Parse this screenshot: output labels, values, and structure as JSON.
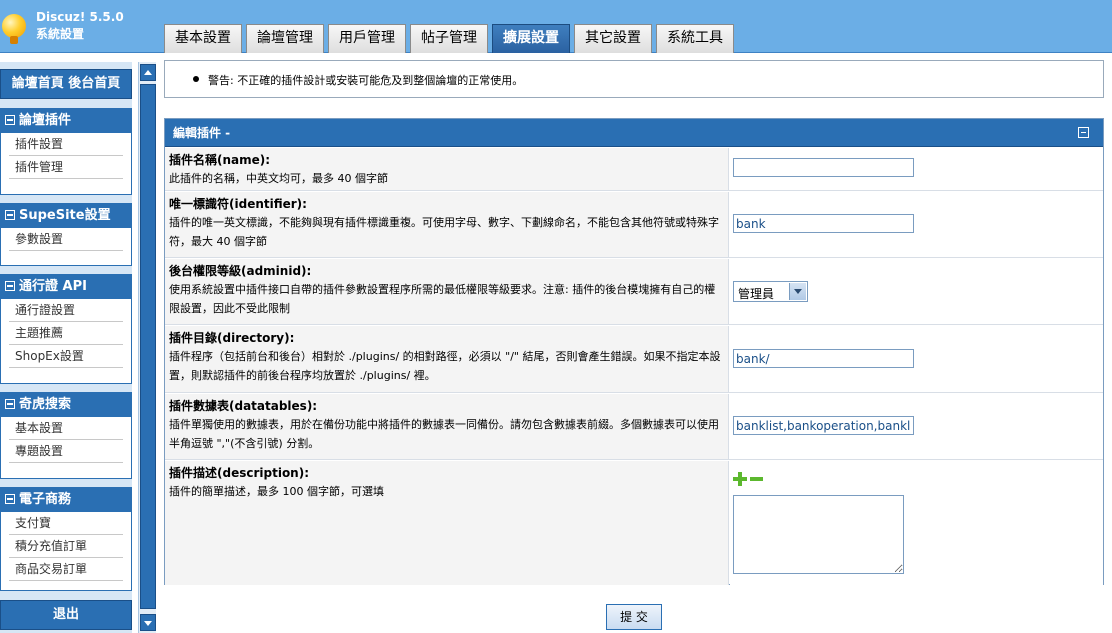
{
  "app": {
    "name": "Discuz! 5.5.0",
    "subtitle": "系統設置"
  },
  "tabs": [
    {
      "label": "基本設置",
      "active": false
    },
    {
      "label": "論壇管理",
      "active": false
    },
    {
      "label": "用戶管理",
      "active": false
    },
    {
      "label": "帖子管理",
      "active": false
    },
    {
      "label": "擴展設置",
      "active": true
    },
    {
      "label": "其它設置",
      "active": false
    },
    {
      "label": "系統工具",
      "active": false
    }
  ],
  "sidebar": {
    "top_label": "論壇首頁  後台首頁",
    "sections": [
      {
        "title": "論壇插件",
        "items": [
          "插件設置",
          "插件管理"
        ]
      },
      {
        "title": "SupeSite設置",
        "items": [
          "參數設置"
        ]
      },
      {
        "title": "通行證 API",
        "items": [
          "通行證設置",
          "主題推薦",
          "ShopEx設置"
        ]
      },
      {
        "title": "奇虎搜索",
        "items": [
          "基本設置",
          "專題設置"
        ]
      },
      {
        "title": "電子商務",
        "items": [
          "支付寶",
          "積分充值訂單",
          "商品交易訂單"
        ]
      }
    ],
    "logout_label": "退出"
  },
  "warning": "警告: 不正確的插件設計或安裝可能危及到整個論壇的正常使用。",
  "form": {
    "title": "編輯插件 -",
    "fields": [
      {
        "label": "插件名稱(name):",
        "desc": "此插件的名稱，中英文均可，最多 40 個字節",
        "value": ""
      },
      {
        "label": "唯一標識符(identifier):",
        "desc": "插件的唯一英文標識，不能夠與現有插件標識重複。可使用字母、數字、下劃線命名，不能包含其他符號或特殊字符，最大 40 個字節",
        "value": "bank"
      },
      {
        "label": "後台權限等級(adminid):",
        "desc": "使用系統設置中插件接口自帶的插件參數設置程序所需的最低權限等級要求。注意: 插件的後台模塊擁有自己的權限設置，因此不受此限制",
        "value": "管理員"
      },
      {
        "label": "插件目錄(directory):",
        "desc": "插件程序（包括前台和後台）相對於 ./plugins/ 的相對路徑，必須以 \"/\" 結尾，否則會產生錯誤。如果不指定本設置，則默認插件的前後台程序均放置於 ./plugins/ 裡。",
        "value": "bank/"
      },
      {
        "label": "插件數據表(datatables):",
        "desc": "插件單獨使用的數據表，用於在備份功能中將插件的數據表一同備份。請勿包含數據表前綴。多個數據表可以使用半角逗號 \",\"(不含引號) 分割。",
        "value": "banklist,bankoperation,banklog"
      },
      {
        "label": "插件描述(description):",
        "desc": "插件的簡單描述，最多 100 個字節，可選填",
        "value": ""
      }
    ]
  },
  "submit_label": "提 交"
}
